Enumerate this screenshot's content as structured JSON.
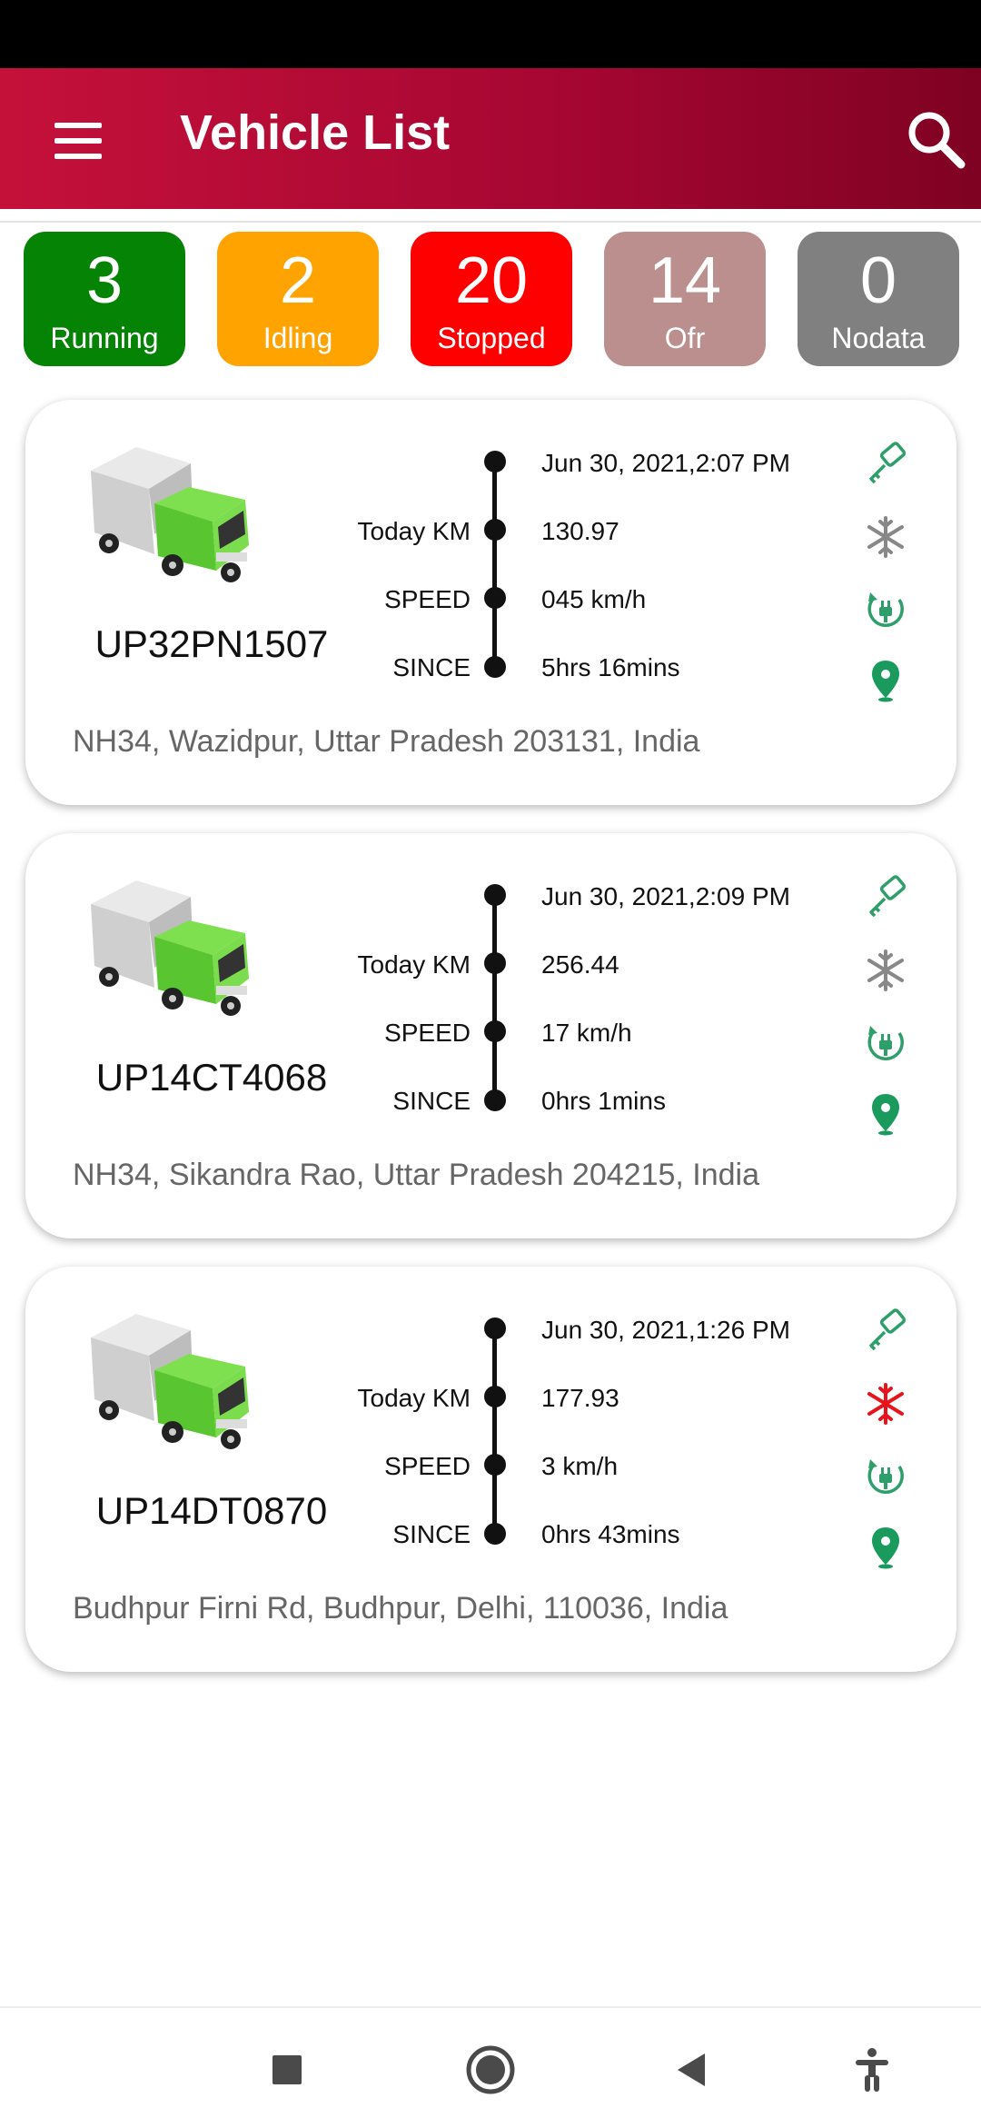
{
  "header": {
    "title": "Vehicle List",
    "menu_icon": "hamburger-menu-icon",
    "search_icon": "search-icon",
    "colors": {
      "from": "#c4113a",
      "to": "#7f0222"
    }
  },
  "status_counts": [
    {
      "count": "3",
      "label": "Running",
      "color": "#058305"
    },
    {
      "count": "2",
      "label": "Idling",
      "color": "#ffa300"
    },
    {
      "count": "20",
      "label": "Stopped",
      "color": "#ff0000"
    },
    {
      "count": "14",
      "label": "Ofr",
      "color": "#bc8f8f"
    },
    {
      "count": "0",
      "label": "Nodata",
      "color": "#808080"
    }
  ],
  "field_labels": {
    "today_km": "Today KM",
    "speed": "SPEED",
    "since": "SINCE"
  },
  "vehicles": [
    {
      "plate": "UP32PN1507",
      "datetime": "Jun 30, 2021,2:07 PM",
      "today_km": "130.97",
      "speed": "045   km/h",
      "since": "5hrs 16mins",
      "address": "NH34, Wazidpur, Uttar Pradesh 203131, India",
      "icons": [
        "key-icon",
        "ac-snowflake-icon",
        "power-plug-icon",
        "location-pin-icon"
      ],
      "ac_color": "#888888"
    },
    {
      "plate": "UP14CT4068",
      "datetime": "Jun 30, 2021,2:09 PM",
      "today_km": "256.44",
      "speed": "17   km/h",
      "since": "0hrs 1mins",
      "address": "NH34, Sikandra Rao, Uttar Pradesh 204215, India",
      "icons": [
        "key-icon",
        "ac-snowflake-icon",
        "power-plug-icon",
        "location-pin-icon"
      ],
      "ac_color": "#888888"
    },
    {
      "plate": "UP14DT0870",
      "datetime": "Jun 30, 2021,1:26 PM",
      "today_km": "177.93",
      "speed": "3   km/h",
      "since": "0hrs 43mins",
      "address": "Budhpur Firni Rd, Budhpur, Delhi, 110036, India",
      "icons": [
        "key-icon",
        "ac-snowflake-icon",
        "power-plug-icon",
        "location-pin-icon"
      ],
      "ac_color": "#e8141c"
    }
  ],
  "navbar": {
    "icons": [
      "recents-square-icon",
      "home-circle-icon",
      "back-triangle-icon",
      "accessibility-icon"
    ]
  }
}
